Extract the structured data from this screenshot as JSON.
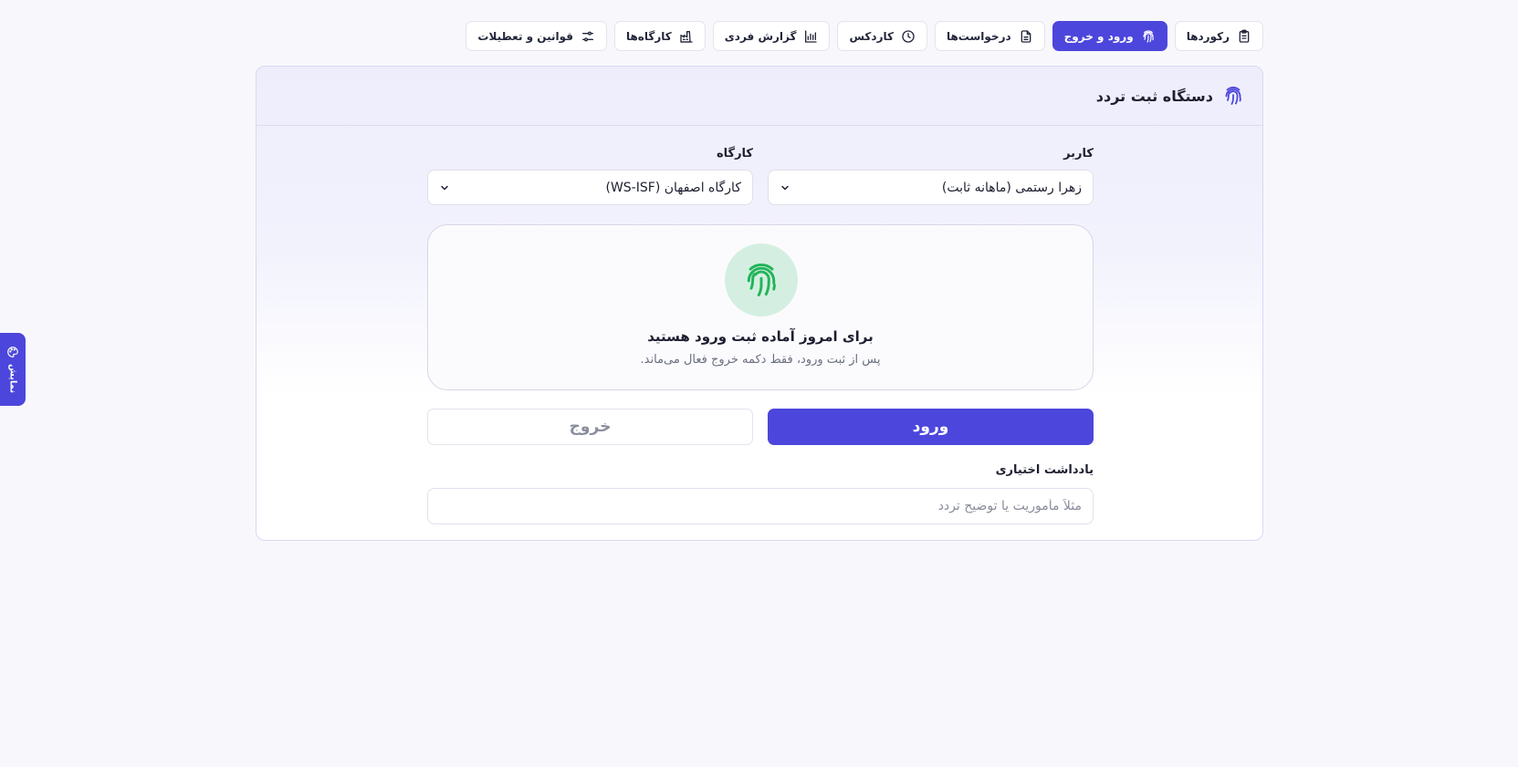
{
  "nav": {
    "tabs": [
      {
        "label": "رکوردها",
        "icon": "clipboard-icon",
        "active": false
      },
      {
        "label": "ورود و خروج",
        "icon": "fingerprint-icon",
        "active": true
      },
      {
        "label": "درخواست‌ها",
        "icon": "document-icon",
        "active": false
      },
      {
        "label": "کاردکس",
        "icon": "clock-icon",
        "active": false
      },
      {
        "label": "گزارش فردی",
        "icon": "bar-chart-icon",
        "active": false
      },
      {
        "label": "کارگاه‌ها",
        "icon": "factory-icon",
        "active": false
      },
      {
        "label": "قوانین و تعطیلات",
        "icon": "sliders-icon",
        "active": false
      }
    ]
  },
  "card": {
    "title": "دستگاه ثبت تردد",
    "icon": "fingerprint-icon"
  },
  "form": {
    "user_label": "کاربر",
    "user_value": "زهرا رستمی (ماهانه ثابت)",
    "workshop_label": "کارگاه",
    "workshop_value": "کارگاه اصفهان (WS-ISF)"
  },
  "status": {
    "title": "برای امروز آماده ثبت ورود هستید",
    "subtitle": "پس از ثبت ورود، فقط دکمه خروج فعال می‌ماند.",
    "icon": "fingerprint-icon",
    "color": "#22b45a"
  },
  "actions": {
    "check_in_label": "ورود",
    "check_out_label": "خروج"
  },
  "note": {
    "label": "یادداشت اختیاری",
    "placeholder": "مثلاً مأموریت یا توضیح تردد",
    "value": ""
  },
  "side_tab": {
    "label": "نمایش",
    "icon": "palette-icon"
  },
  "colors": {
    "accent": "#4c46dc",
    "success": "#22b45a",
    "success_bg": "#d4efe1"
  }
}
